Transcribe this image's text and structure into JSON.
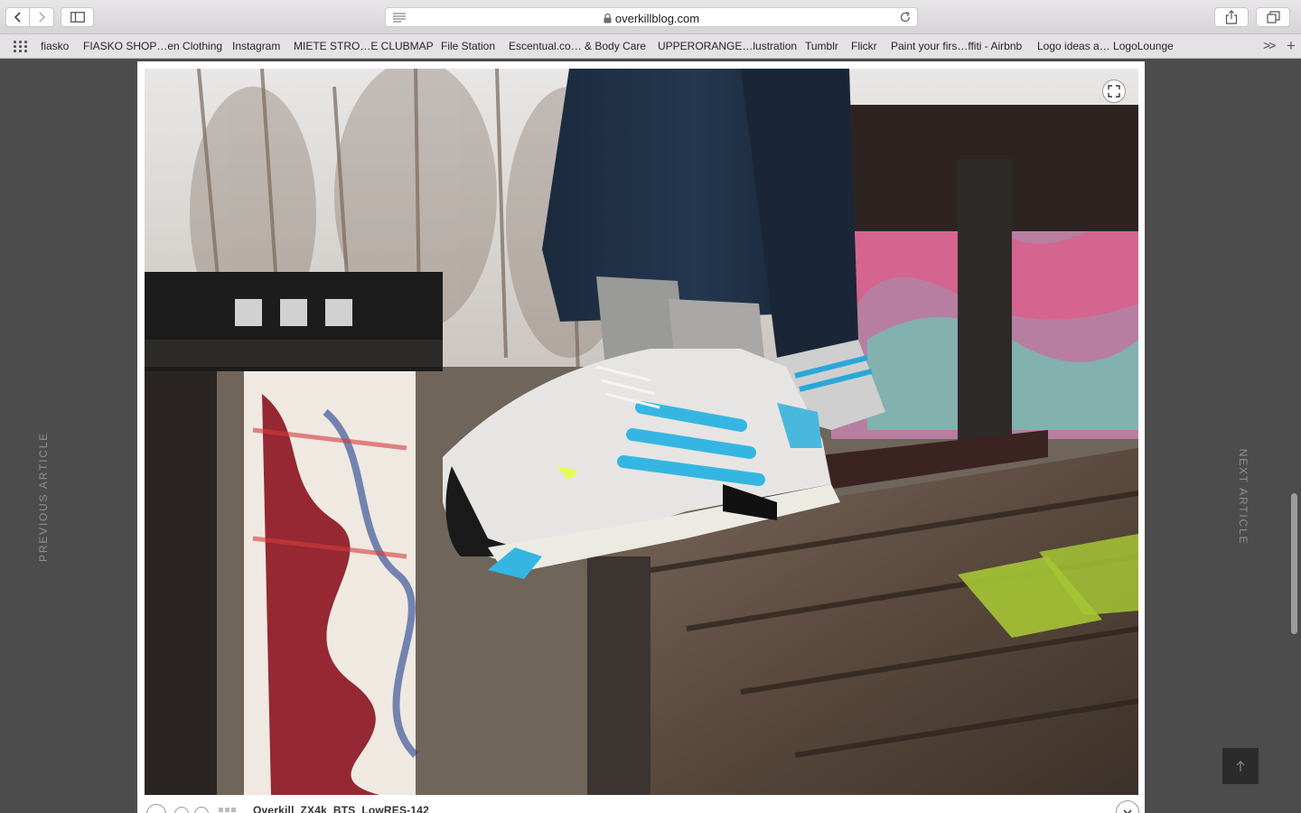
{
  "browser": {
    "url": "overkillblog.com",
    "icons": {
      "back": "chevron-left-icon",
      "forward": "chevron-right-icon",
      "sidebar": "sidebar-icon",
      "reader": "reader-icon",
      "lock": "lock-icon",
      "reload": "reload-icon",
      "share": "share-icon",
      "tabs": "tabs-icon"
    }
  },
  "bookmarks": {
    "items": [
      "fiasko",
      "FIASKO SHOP…en Clothing",
      "Instagram",
      "MIETE STRO…E CLUBMAP",
      "File Station",
      "Escentual.co… & Body Care",
      "UPPERORANGE…lustration",
      "Tumblr",
      "Flickr",
      "Paint your firs…ffiti - Airbnb",
      "Logo ideas a… LogoLounge"
    ],
    "more": ">>",
    "add": "+"
  },
  "page": {
    "previous_label": "PREVIOUS ARTICLE",
    "next_label": "NEXT ARTICLE",
    "lightbox": {
      "caption": "Overkill_ZX4k_BTS_LowRES-142",
      "photo_subject": "White, grey and teal Adidas sneakers on a wooden park bench with graffiti"
    },
    "colors": {
      "background": "#4c4c4c",
      "lightbox": "#ffffff",
      "scroll_top": "#2b2b2b"
    }
  }
}
